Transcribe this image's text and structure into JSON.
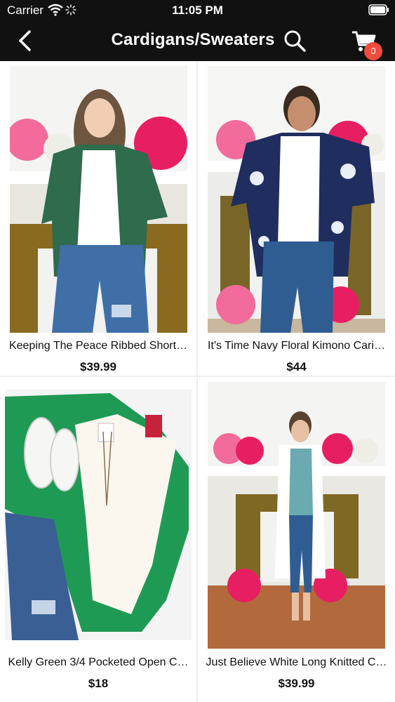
{
  "status_bar": {
    "carrier": "Carrier",
    "time": "11:05 PM",
    "icons": [
      "wifi-icon",
      "activity-spinner-icon",
      "battery-icon"
    ]
  },
  "nav": {
    "title": "Cardigans/Sweaters",
    "cart_count": "0",
    "icons": [
      "back-chevron-icon",
      "search-icon",
      "cart-icon"
    ],
    "badge_color": "#f04c3e",
    "bar_color": "#111111"
  },
  "products": [
    {
      "name": "Keeping The Peace Ribbed Short…",
      "price": "$39.99",
      "image": "woman-green-cardigan-photo"
    },
    {
      "name": "It's Time Navy Floral Kimono Cari…",
      "price": "$44",
      "image": "woman-navy-floral-kimono-photo"
    },
    {
      "name": "Kelly Green 3/4 Pocketed Open C…",
      "price": "$18",
      "image": "green-cardigan-flatlay-photo"
    },
    {
      "name": "Just Believe White Long Knitted C…",
      "price": "$39.99",
      "image": "woman-white-knit-vest-photo"
    }
  ]
}
